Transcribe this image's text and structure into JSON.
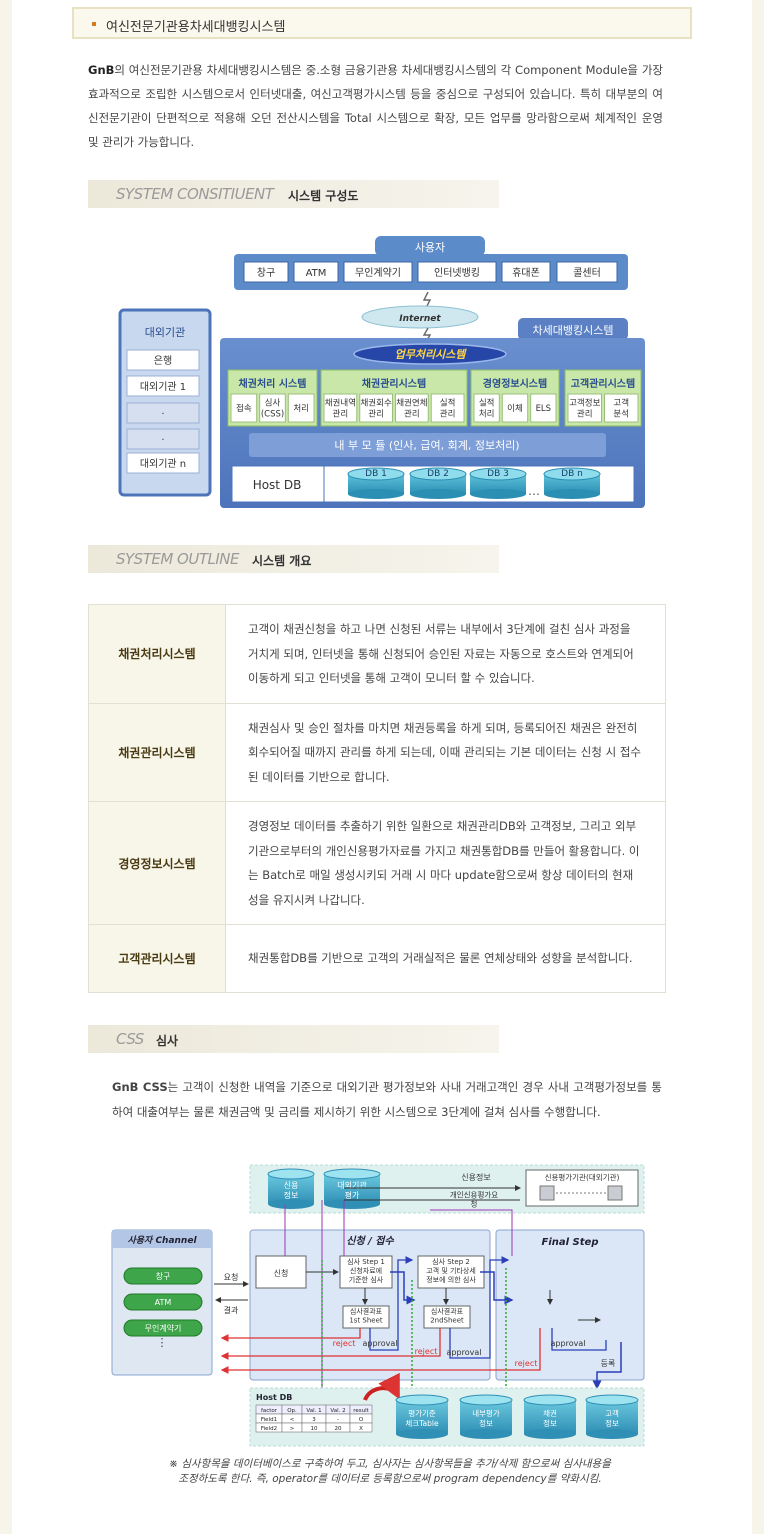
{
  "page_title": "여신전문기관용차세대뱅킹시스템",
  "intro": {
    "brand": "GnB",
    "text": "의 여신전문기관용 차세대뱅킹시스템은 중.소형 금융기관용 차세대뱅킹시스템의 각 Component Module을 가장 효과적으로 조립한 시스템으로서 인터넷대출, 여신고객평가시스템 등을 중심으로 구성되어 있습니다. 특히 대부분의 여신전문기관이 단편적으로 적용해 오던 전산시스템을 Total 시스템으로 확장, 모든 업무를 망라함으로써 체계적인 운영 및 관리가 가능합니다."
  },
  "section1": {
    "en": "SYSTEM CONSITIUENT",
    "ko": "시스템 구성도"
  },
  "diagram1": {
    "user_title": "사용자",
    "channels": [
      "창구",
      "ATM",
      "무인계약기",
      "인터넷뱅킹",
      "휴대폰",
      "콜센터"
    ],
    "internet": "Internet",
    "system_title": "차세대뱅킹시스템",
    "business_title": "업무처리시스템",
    "external_title": "대외기관",
    "external_items": [
      "은행",
      "대외기관 1",
      "·",
      "·",
      "대외기관 n"
    ],
    "modules": [
      {
        "title": "채권처리 시스템",
        "items": [
          "접속",
          "심사\n(CSS)",
          "처리"
        ]
      },
      {
        "title": "채권관리시스템",
        "items": [
          "채권내역\n관리",
          "채권회수\n관리",
          "채권연체\n관리",
          "실적\n관리"
        ]
      },
      {
        "title": "경영정보시스템",
        "items": [
          "실적\n처리",
          "이체",
          "ELS"
        ]
      },
      {
        "title": "고객관리시스템",
        "items": [
          "고객정보\n관리",
          "고객\n분석"
        ]
      }
    ],
    "internal_module": "내 부 모 듈 (인사, 급여, 회계, 정보처리)",
    "host_db": "Host DB",
    "dbs": [
      "DB 1",
      "DB 2",
      "DB 3",
      "DB n"
    ],
    "ellipsis": "…"
  },
  "section2": {
    "en": "SYSTEM OUTLINE",
    "ko": "시스템 개요"
  },
  "outline": [
    {
      "name": "채권처리시스템",
      "desc": "고객이 채권신청을 하고 나면 신청된 서류는 내부에서 3단계에 걸친 심사 과정을 거치게 되며, 인터넷을 통해 신청되어 승인된 자료는 자동으로 호스트와 연계되어 이동하게 되고 인터넷을 통해 고객이 모니터 할 수 있습니다."
    },
    {
      "name": "채권관리시스템",
      "desc": "채권심사 및 승인 절차를 마치면 채권등록을 하게 되며, 등록되어진 채권은 완전히 회수되어질 때까지 관리를 하게 되는데, 이때 관리되는 기본 데이터는 신청 시 접수된 데이터를 기반으로 합니다."
    },
    {
      "name": "경영정보시스템",
      "desc": "경영정보 데이터를 추출하기 위한 일환으로 채권관리DB와 고객정보, 그리고 외부기관으로부터의 개인신용평가자료를 가지고 채권통합DB를 만들어 활용합니다. 이는 Batch로 매일 생성시키되 거래 시 마다 update함으로써 항상 데이터의 현재성을 유지시켜 나갑니다."
    },
    {
      "name": "고객관리시스템",
      "desc": "채권통합DB를 기반으로 고객의 거래실적은 물론 연체상태와 성향을 분석합니다."
    }
  ],
  "section3": {
    "en": "CSS",
    "ko": "심사"
  },
  "css_intro": {
    "brand": "GnB CSS",
    "text": "는 고객이 신청한 내역을 기준으로 대외기관 평가정보와 사내 거래고객인 경우 사내 고객평가정보를 통하여 대출여부는 물론 채권금액 및 금리를 제시하기 위한 시스템으로 3단계에 걸쳐 심사를 수행합니다."
  },
  "diagram2": {
    "top_db1": "신용\n정보",
    "top_db2": "대외기관\n평가",
    "credit_info": "신용정보",
    "personal_credit": "개인신용평가요\n청",
    "agency_box": "신용평가기관(대외기관)",
    "channel_title": "사용자 Channel",
    "channel_items": [
      "창구",
      "ATM",
      "무인계약기"
    ],
    "request_label": "요청",
    "result_label": "결과",
    "apply_title": "신청 / 접수",
    "apply_box": "신청",
    "step1": "심사 Step 1\n신청자료에\n기준한 심사",
    "step2": "심사 Step 2\n고객 및 기타상세\n정보에 의한 심사",
    "result1": "심사결과표\n1st Sheet",
    "result2": "심사결과표\n2ndSheet",
    "final_title": "Final Step",
    "final_box": "Final 심사\nStep2의 심사와 동일한\n심사를 반복하여 확인",
    "final_result": "심사결과표\nFinal Sheet",
    "confirm": "최종\n확인\n(심사자\n의견)",
    "reject": "reject",
    "approval": "approval",
    "register": "등록",
    "host_db_title": "Host DB",
    "table_headers": [
      "factor",
      "Op.",
      "Val. 1",
      "Val. 2",
      "result"
    ],
    "table_rows": [
      [
        "Field1",
        "<",
        "3",
        "-",
        "O"
      ],
      [
        "Field2",
        ">",
        "10",
        "20",
        "X"
      ]
    ],
    "bottom_dbs": [
      "평가기준\n체크Table",
      "내부평가\n정보",
      "채권\n정보",
      "고객\n정보"
    ]
  },
  "footnote": "※ 심사항목을 데이터베이스로 구축하여 두고, 심사자는 심사항목들을 추가/삭제 함으로써 심사내용을\n조정하도록 한다. 즉, operator를 데이터로 등록함으로써 program dependency를 약화시킴."
}
